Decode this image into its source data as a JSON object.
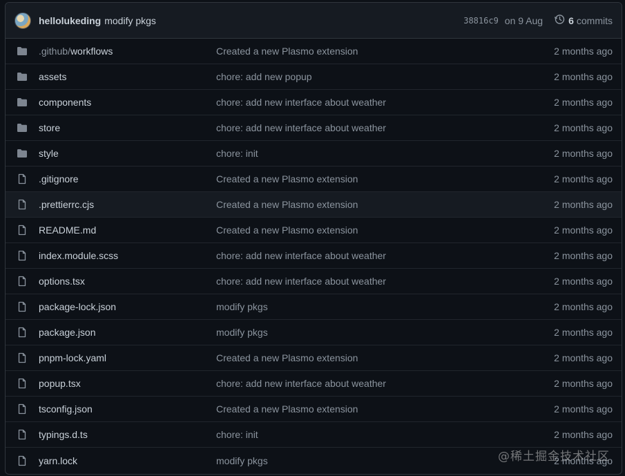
{
  "header": {
    "author": "hellolukeding",
    "message": "modify pkgs",
    "sha": "38816c9",
    "date": "on 9 Aug",
    "commits_count": "6",
    "commits_label": "commits"
  },
  "files": [
    {
      "name_prefix": ".github/",
      "name": "workflows",
      "type": "folder",
      "message": "Created a new Plasmo extension",
      "age": "2 months ago"
    },
    {
      "name": "assets",
      "type": "folder",
      "message": "chore: add new popup",
      "age": "2 months ago"
    },
    {
      "name": "components",
      "type": "folder",
      "message": "chore: add new interface about weather",
      "age": "2 months ago"
    },
    {
      "name": "store",
      "type": "folder",
      "message": "chore: add new interface about weather",
      "age": "2 months ago"
    },
    {
      "name": "style",
      "type": "folder",
      "message": "chore: init",
      "age": "2 months ago"
    },
    {
      "name": ".gitignore",
      "type": "file",
      "message": "Created a new Plasmo extension",
      "age": "2 months ago"
    },
    {
      "name": ".prettierrc.cjs",
      "type": "file",
      "message": "Created a new Plasmo extension",
      "age": "2 months ago"
    },
    {
      "name": "README.md",
      "type": "file",
      "message": "Created a new Plasmo extension",
      "age": "2 months ago"
    },
    {
      "name": "index.module.scss",
      "type": "file",
      "message": "chore: add new interface about weather",
      "age": "2 months ago"
    },
    {
      "name": "options.tsx",
      "type": "file",
      "message": "chore: add new interface about weather",
      "age": "2 months ago"
    },
    {
      "name": "package-lock.json",
      "type": "file",
      "message": "modify pkgs",
      "age": "2 months ago"
    },
    {
      "name": "package.json",
      "type": "file",
      "message": "modify pkgs",
      "age": "2 months ago"
    },
    {
      "name": "pnpm-lock.yaml",
      "type": "file",
      "message": "Created a new Plasmo extension",
      "age": "2 months ago"
    },
    {
      "name": "popup.tsx",
      "type": "file",
      "message": "chore: add new interface about weather",
      "age": "2 months ago"
    },
    {
      "name": "tsconfig.json",
      "type": "file",
      "message": "Created a new Plasmo extension",
      "age": "2 months ago"
    },
    {
      "name": "typings.d.ts",
      "type": "file",
      "message": "chore: init",
      "age": "2 months ago"
    },
    {
      "name": "yarn.lock",
      "type": "file",
      "message": "modify pkgs",
      "age": "2 months ago"
    }
  ],
  "watermark": "@稀土掘金技术社区",
  "colors": {
    "background": "#0d1117",
    "header": "#161b22",
    "border": "#30363d",
    "text": "#c9d1d9",
    "muted": "#8b949e",
    "folder": "#7d8590"
  }
}
